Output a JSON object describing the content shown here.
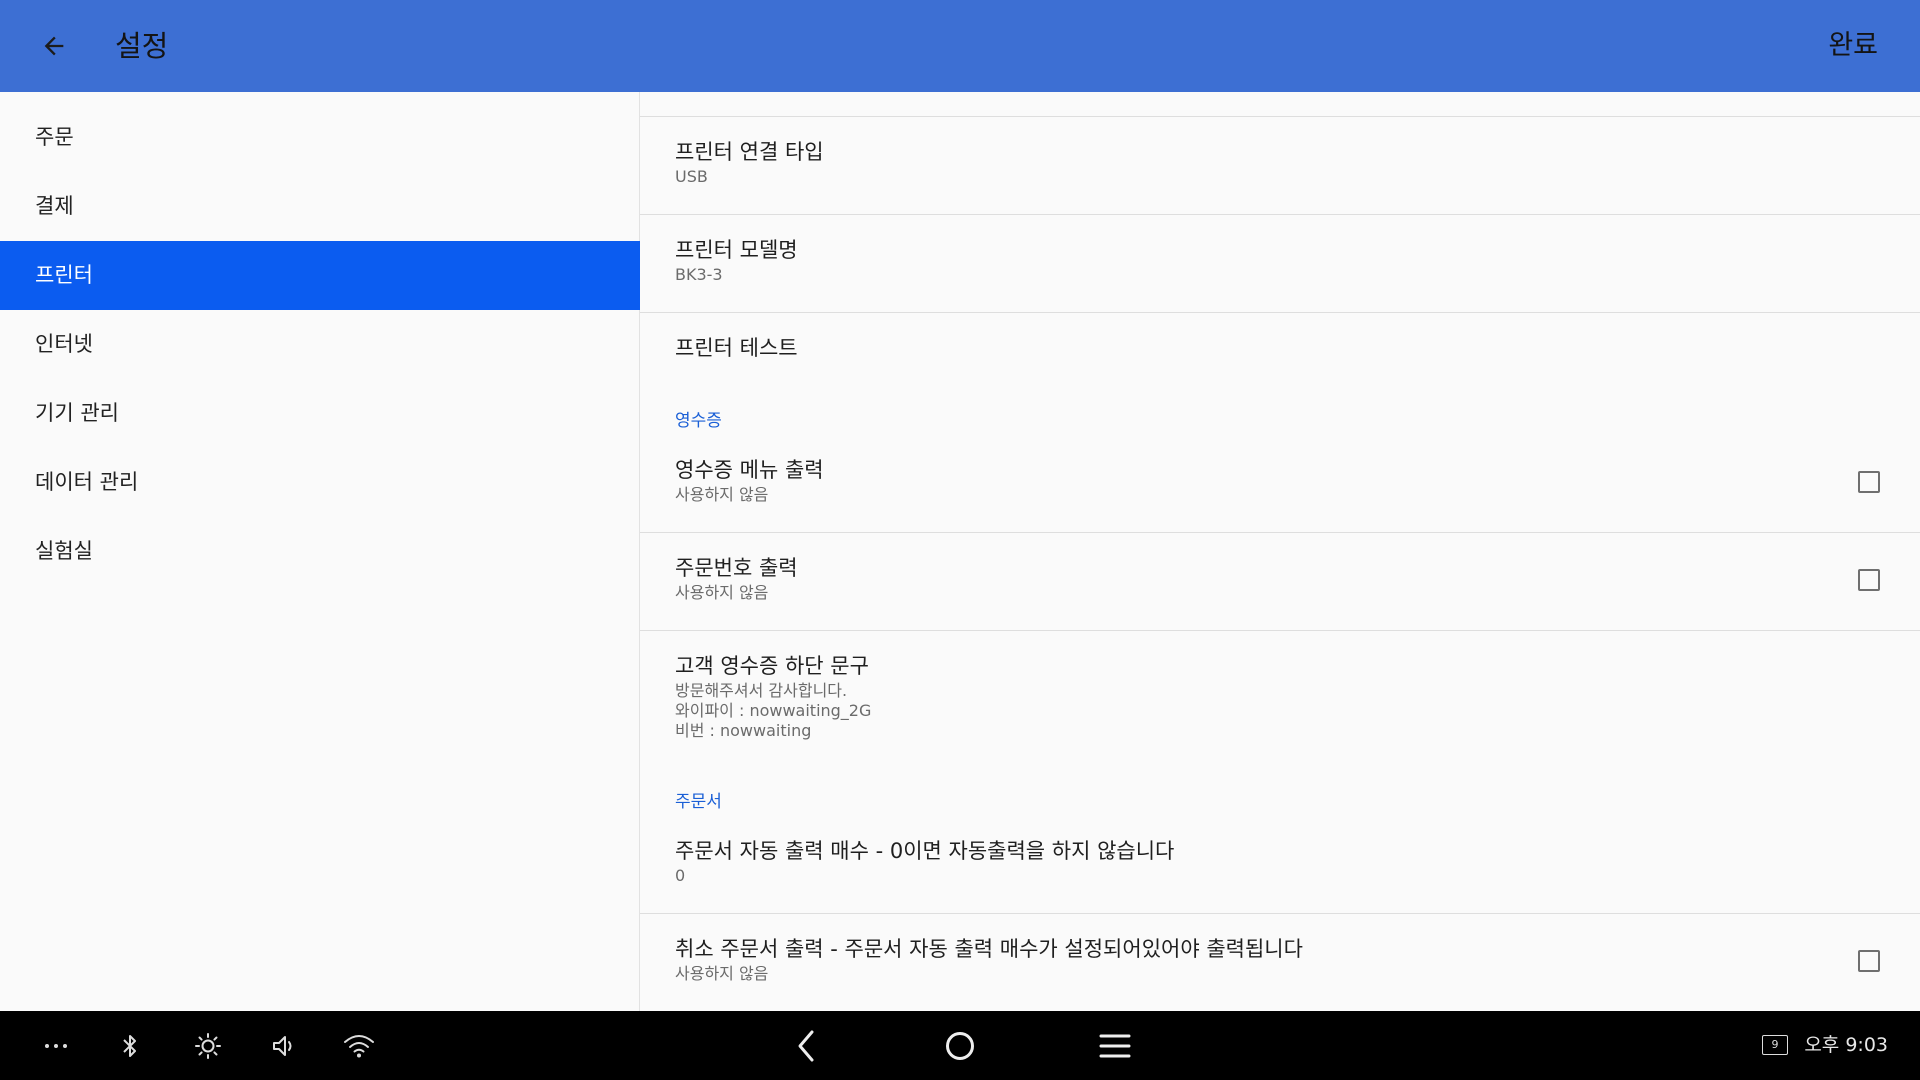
{
  "header": {
    "title": "설정",
    "done_label": "완료"
  },
  "sidebar": {
    "items": [
      {
        "label": "주문"
      },
      {
        "label": "결제"
      },
      {
        "label": "프린터",
        "active": true
      },
      {
        "label": "인터넷"
      },
      {
        "label": "기기 관리"
      },
      {
        "label": "데이터 관리"
      },
      {
        "label": "실험실"
      }
    ]
  },
  "content": {
    "printer_connection": {
      "title": "프린터 연결 타입",
      "summary": "USB"
    },
    "printer_model": {
      "title": "프린터 모델명",
      "summary": "BK3-3"
    },
    "printer_test": {
      "title": "프린터 테스트"
    },
    "receipt_category": "영수증",
    "receipt_menu_print": {
      "title": "영수증 메뉴 출력",
      "summary": "사용하지 않음",
      "checked": false
    },
    "order_number_print": {
      "title": "주문번호 출력",
      "summary": "사용하지 않음",
      "checked": false
    },
    "receipt_footer": {
      "title": "고객 영수증 하단 문구",
      "summary": "방문해주셔서 감사합니다.\n와이파이 : nowwaiting_2G\n비번 : nowwaiting"
    },
    "order_sheet_category": "주문서",
    "order_auto_print_count": {
      "title": "주문서 자동 출력 매수 - 0이면 자동출력을 하지 않습니다",
      "summary": "0"
    },
    "cancel_order_print": {
      "title": "취소 주문서 출력 - 주문서 자동 출력 매수가 설정되어있어야 출력됩니다",
      "summary": "사용하지 않음",
      "checked": false
    }
  },
  "navbar": {
    "time": "오후 9:03",
    "badge": "9"
  },
  "colors": {
    "appbar": "#3d6fd3",
    "active_item": "#0b5cf0",
    "category": "#1a5fd6"
  }
}
